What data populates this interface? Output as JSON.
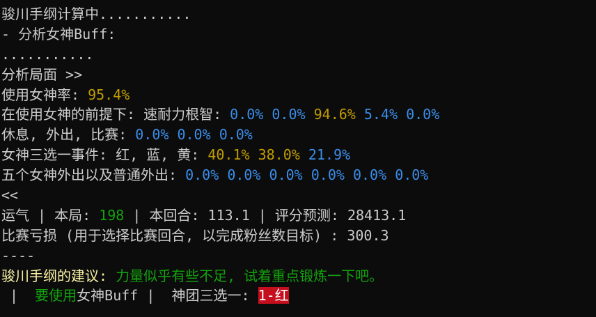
{
  "colors": {
    "background": "#0c0c0c",
    "default_text": "#cccccc",
    "yellow": "#c19c00",
    "blue": "#3b8eea",
    "green": "#13a10e",
    "light_yellow": "#f9f1a5",
    "red_highlight": "#c50f1f"
  },
  "lines": {
    "l1": "骏川手纲计算中...........",
    "l2": "- 分析女神Buff:",
    "l3": "...........",
    "l4": "分析局面 >>",
    "l5": {
      "label": "使用女神率: ",
      "value": "95.4%"
    },
    "l6": {
      "label": "在使用女神的前提下: 速耐力根智: ",
      "values": [
        "0.0%",
        "0.0%",
        "94.6%",
        "5.4%",
        "0.0%"
      ]
    },
    "l7": {
      "label": "休息, 外出, 比赛: ",
      "values": [
        "0.0%",
        "0.0%",
        "0.0%"
      ]
    },
    "l8": {
      "label": "女神三选一事件: 红, 蓝, 黄: ",
      "values": [
        "40.1%",
        "38.0%",
        "21.9%"
      ]
    },
    "l9": {
      "label": "五个女神外出以及普通外出: ",
      "values": [
        "0.0%",
        "0.0%",
        "0.0%",
        "0.0%",
        "0.0%",
        "0.0%"
      ]
    },
    "l10": "<<",
    "l11": {
      "prefix": "运气 | 本局: ",
      "round_value": "198",
      "mid": " | 本回合: 113.1 | 评分预测: 28413.1"
    },
    "l12": "比赛亏损 (用于选择比赛回合, 以完成粉丝数目标) : 300.3",
    "l13": "----",
    "l14": {
      "label": "骏川手纲的建议: ",
      "advice": "力量似乎有些不足, 试着重点锻炼一下吧。"
    },
    "l15": {
      "sep1": " |  ",
      "use": "要使用",
      "buff": "女神Buff",
      "sep2": " |  神团三选一: ",
      "choice": "1-红"
    }
  }
}
